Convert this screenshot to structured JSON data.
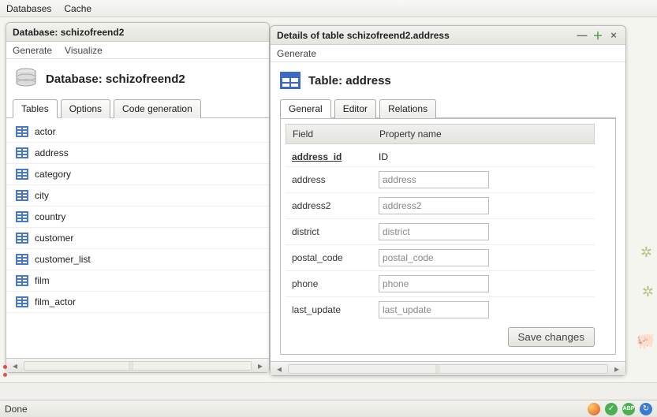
{
  "top_menu": {
    "item0": "Databases",
    "item1": "Cache"
  },
  "left": {
    "title": "Database: schizofreend2",
    "submenu": {
      "generate": "Generate",
      "visualize": "Visualize"
    },
    "db_heading": "Database: schizofreend2",
    "tabs": {
      "t0": "Tables",
      "t1": "Options",
      "t2": "Code generation"
    },
    "tables": {
      "r0": "actor",
      "r1": "address",
      "r2": "category",
      "r3": "city",
      "r4": "country",
      "r5": "customer",
      "r6": "customer_list",
      "r7": "film",
      "r8": "film_actor"
    }
  },
  "right": {
    "title": "Details of table schizofreend2.address",
    "submenu": {
      "generate": "Generate"
    },
    "heading": "Table: address",
    "tabs": {
      "t0": "General",
      "t1": "Editor",
      "t2": "Relations"
    },
    "col0": "Field",
    "col1": "Property name",
    "fields": {
      "f0": {
        "name": "address_id",
        "prop": "ID",
        "pk": true,
        "readonly": true
      },
      "f1": {
        "name": "address",
        "prop": "address"
      },
      "f2": {
        "name": "address2",
        "prop": "address2"
      },
      "f3": {
        "name": "district",
        "prop": "district"
      },
      "f4": {
        "name": "postal_code",
        "prop": "postal_code"
      },
      "f5": {
        "name": "phone",
        "prop": "phone"
      },
      "f6": {
        "name": "last_update",
        "prop": "last_update"
      }
    },
    "save_label": "Save changes"
  },
  "status": {
    "done": "Done"
  }
}
